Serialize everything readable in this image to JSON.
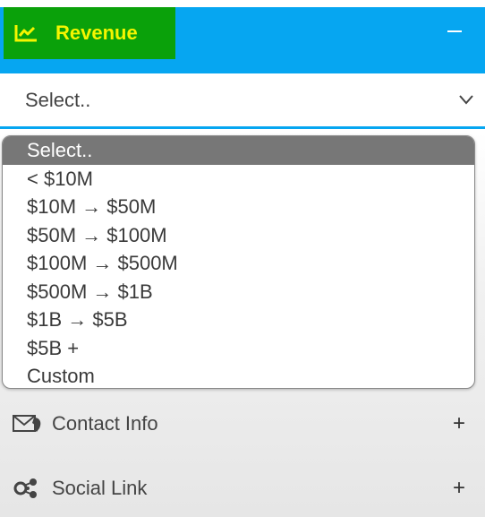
{
  "header": {
    "title": "Revenue",
    "collapse_label": "−"
  },
  "select": {
    "value": "Select..",
    "options": [
      "Select..",
      "< $10M",
      "$10M → $50M",
      "$50M → $100M",
      "$100M → $500M",
      "$500M → $1B",
      "$1B → $5B",
      "$5B +",
      "Custom"
    ]
  },
  "sections": [
    {
      "label": "Contact Info",
      "toggle": "+",
      "icon": "envelope-phone-icon"
    },
    {
      "label": "Social Link",
      "toggle": "+",
      "icon": "share-network-icon"
    }
  ],
  "colors": {
    "header_bg": "#06a6f1",
    "label_bg": "#0aa10a",
    "title_text": "#f5f500",
    "selected_option": "#777777"
  }
}
